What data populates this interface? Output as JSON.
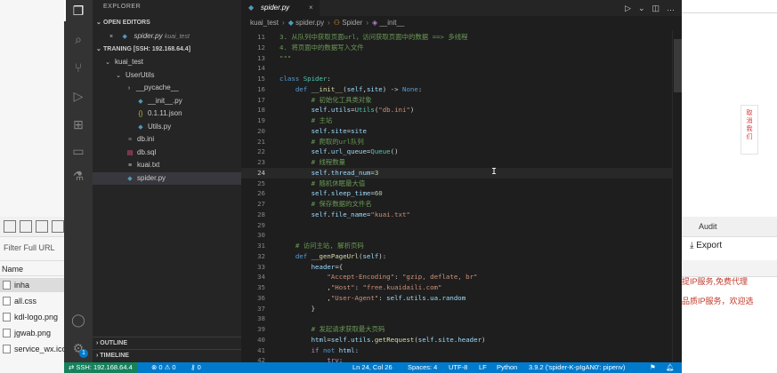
{
  "background": {
    "left": {
      "filter_placeholder": "Filter Full URL",
      "name_header": "Name",
      "files": [
        {
          "name": "inha",
          "selected": true
        },
        {
          "name": "all.css",
          "selected": false
        },
        {
          "name": "kdl-logo.png",
          "selected": false
        },
        {
          "name": "jgwab.png",
          "selected": false
        },
        {
          "name": "service_wx.ico",
          "selected": false
        }
      ]
    },
    "right": {
      "side_button": "取\n消\n我\n们",
      "audit": "Audit",
      "export": "Export",
      "red_text_1": "提IP服务,免费代理",
      "red_text_2": "品质IP服务，欢迎选"
    }
  },
  "vscode": {
    "explorer_title": "EXPLORER",
    "open_editors_label": "OPEN EDITORS",
    "open_editor": {
      "close": "×",
      "name": "spider.py",
      "path": "kuai_test"
    },
    "workspace_label": "TRANING [SSH: 192.168.64.4]",
    "tree": [
      {
        "label": "kuai_test",
        "chevron": "⌄",
        "icon": "",
        "depth": 1
      },
      {
        "label": "UserUtils",
        "chevron": "⌄",
        "icon": "",
        "depth": 2
      },
      {
        "label": "__pycache__",
        "chevron": "›",
        "icon": "",
        "depth": 3
      },
      {
        "label": "__init__.py",
        "chevron": "",
        "icon": "py",
        "depth": 3
      },
      {
        "label": "0.1.11.json",
        "chevron": "",
        "icon": "{}",
        "depth": 3
      },
      {
        "label": "Utils.py",
        "chevron": "",
        "icon": "py",
        "depth": 3
      },
      {
        "label": "db.ini",
        "chevron": "",
        "icon": "ini",
        "depth": 2
      },
      {
        "label": "db.sql",
        "chevron": "",
        "icon": "db",
        "depth": 2
      },
      {
        "label": "kuai.txt",
        "chevron": "",
        "icon": "txt",
        "depth": 2
      },
      {
        "label": "spider.py",
        "chevron": "",
        "icon": "py",
        "depth": 2,
        "selected": true
      }
    ],
    "outline_label": "OUTLINE",
    "timeline_label": "TIMELINE",
    "tab": {
      "name": "spider.py",
      "close": "×"
    },
    "breadcrumb": {
      "folder": "kuai_test",
      "file": "spider.py",
      "class": "Spider",
      "method": "__init__"
    },
    "status": {
      "remote": "SSH: 192.168.64.4",
      "problems": "⊗ 0 ⚠ 0",
      "ports": "0",
      "position": "Ln 24, Col 26",
      "spaces": "Spaces: 4",
      "encoding": "UTF-8",
      "eol": "LF",
      "language": "Python",
      "interpreter": "3.9.2 ('spider-K-pIgAN0': pipenv)",
      "badge": "1"
    },
    "code": [
      {
        "n": "11",
        "t": [
          [
            "cmt",
            "3. 从队列中获取页面url，访问获取页面中的数据 ==> 多线程"
          ]
        ]
      },
      {
        "n": "12",
        "t": [
          [
            "cmt",
            "4. 将页面中的数据写入文件"
          ]
        ]
      },
      {
        "n": "13",
        "t": [
          [
            "cmt",
            "\"\"\""
          ]
        ]
      },
      {
        "n": "14",
        "t": []
      },
      {
        "n": "15",
        "t": [
          [
            "kw",
            "class "
          ],
          [
            "cls",
            "Spider"
          ],
          [
            "plain",
            ":"
          ]
        ]
      },
      {
        "n": "16",
        "t": [
          [
            "plain",
            "    "
          ],
          [
            "kw",
            "def "
          ],
          [
            "fn",
            "__init__"
          ],
          [
            "plain",
            "("
          ],
          [
            "var",
            "self"
          ],
          [
            "plain",
            ","
          ],
          [
            "var",
            "site"
          ],
          [
            "plain",
            ") -> "
          ],
          [
            "kw",
            "None"
          ],
          [
            "plain",
            ":"
          ]
        ]
      },
      {
        "n": "17",
        "t": [
          [
            "plain",
            "        "
          ],
          [
            "cmt",
            "# 初始化工具类对象"
          ]
        ]
      },
      {
        "n": "18",
        "t": [
          [
            "plain",
            "        "
          ],
          [
            "var",
            "self"
          ],
          [
            "plain",
            "."
          ],
          [
            "var",
            "utils"
          ],
          [
            "plain",
            "="
          ],
          [
            "cls",
            "Utils"
          ],
          [
            "plain",
            "("
          ],
          [
            "str",
            "\"db.ini\""
          ],
          [
            "plain",
            ")"
          ]
        ]
      },
      {
        "n": "19",
        "t": [
          [
            "plain",
            "        "
          ],
          [
            "cmt",
            "# 主站"
          ]
        ]
      },
      {
        "n": "20",
        "t": [
          [
            "plain",
            "        "
          ],
          [
            "var",
            "self"
          ],
          [
            "plain",
            "."
          ],
          [
            "var",
            "site"
          ],
          [
            "plain",
            "="
          ],
          [
            "var",
            "site"
          ]
        ]
      },
      {
        "n": "21",
        "t": [
          [
            "plain",
            "        "
          ],
          [
            "cmt",
            "# 爬取的url队列"
          ]
        ]
      },
      {
        "n": "22",
        "t": [
          [
            "plain",
            "        "
          ],
          [
            "var",
            "self"
          ],
          [
            "plain",
            "."
          ],
          [
            "var",
            "url_queue"
          ],
          [
            "plain",
            "="
          ],
          [
            "cls",
            "Queue"
          ],
          [
            "plain",
            "()"
          ]
        ]
      },
      {
        "n": "23",
        "t": [
          [
            "plain",
            "        "
          ],
          [
            "cmt",
            "# 线程数量"
          ]
        ]
      },
      {
        "n": "24",
        "t": [
          [
            "plain",
            "        "
          ],
          [
            "var",
            "self"
          ],
          [
            "plain",
            "."
          ],
          [
            "var",
            "thread_num"
          ],
          [
            "plain",
            "="
          ],
          [
            "num",
            "3"
          ]
        ],
        "current": true
      },
      {
        "n": "25",
        "t": [
          [
            "plain",
            "        "
          ],
          [
            "cmt",
            "# 随机休眠最大值"
          ]
        ]
      },
      {
        "n": "26",
        "t": [
          [
            "plain",
            "        "
          ],
          [
            "var",
            "self"
          ],
          [
            "plain",
            "."
          ],
          [
            "var",
            "sleep_time"
          ],
          [
            "plain",
            "="
          ],
          [
            "num",
            "60"
          ]
        ]
      },
      {
        "n": "27",
        "t": [
          [
            "plain",
            "        "
          ],
          [
            "cmt",
            "# 保存数据的文件名"
          ]
        ]
      },
      {
        "n": "28",
        "t": [
          [
            "plain",
            "        "
          ],
          [
            "var",
            "self"
          ],
          [
            "plain",
            "."
          ],
          [
            "var",
            "file_name"
          ],
          [
            "plain",
            "="
          ],
          [
            "str",
            "\"kuai.txt\""
          ]
        ]
      },
      {
        "n": "29",
        "t": []
      },
      {
        "n": "30",
        "t": []
      },
      {
        "n": "31",
        "t": [
          [
            "plain",
            "    "
          ],
          [
            "cmt",
            "# 访问主站, 解析页码"
          ]
        ]
      },
      {
        "n": "32",
        "t": [
          [
            "plain",
            "    "
          ],
          [
            "kw",
            "def "
          ],
          [
            "fn",
            "__genPageUrl"
          ],
          [
            "plain",
            "("
          ],
          [
            "var",
            "self"
          ],
          [
            "plain",
            "):"
          ]
        ]
      },
      {
        "n": "33",
        "t": [
          [
            "plain",
            "        "
          ],
          [
            "var",
            "header"
          ],
          [
            "plain",
            "={"
          ]
        ]
      },
      {
        "n": "34",
        "t": [
          [
            "plain",
            "            "
          ],
          [
            "str",
            "\"Accept-Encoding\""
          ],
          [
            "plain",
            ": "
          ],
          [
            "str",
            "\"gzip, deflate, br\""
          ]
        ]
      },
      {
        "n": "35",
        "t": [
          [
            "plain",
            "            ,"
          ],
          [
            "str",
            "\"Host\""
          ],
          [
            "plain",
            ": "
          ],
          [
            "str",
            "\"free.kuaidaili.com\""
          ]
        ]
      },
      {
        "n": "36",
        "t": [
          [
            "plain",
            "            ,"
          ],
          [
            "str",
            "\"User-Agent\""
          ],
          [
            "plain",
            ": "
          ],
          [
            "var",
            "self"
          ],
          [
            "plain",
            "."
          ],
          [
            "var",
            "utils"
          ],
          [
            "plain",
            "."
          ],
          [
            "var",
            "ua"
          ],
          [
            "plain",
            "."
          ],
          [
            "var",
            "random"
          ]
        ]
      },
      {
        "n": "37",
        "t": [
          [
            "plain",
            "        }"
          ]
        ]
      },
      {
        "n": "38",
        "t": []
      },
      {
        "n": "39",
        "t": [
          [
            "plain",
            "        "
          ],
          [
            "cmt",
            "# 发起请求获取最大页码"
          ]
        ]
      },
      {
        "n": "40",
        "t": [
          [
            "plain",
            "        "
          ],
          [
            "var",
            "html"
          ],
          [
            "plain",
            "="
          ],
          [
            "var",
            "self"
          ],
          [
            "plain",
            "."
          ],
          [
            "var",
            "utils"
          ],
          [
            "plain",
            "."
          ],
          [
            "fn",
            "getRequest"
          ],
          [
            "plain",
            "("
          ],
          [
            "var",
            "self"
          ],
          [
            "plain",
            "."
          ],
          [
            "var",
            "site"
          ],
          [
            "plain",
            "."
          ],
          [
            "var",
            "header"
          ],
          [
            "plain",
            ")"
          ]
        ]
      },
      {
        "n": "41",
        "t": [
          [
            "plain",
            "        "
          ],
          [
            "kw2",
            "if "
          ],
          [
            "kw",
            "not "
          ],
          [
            "var",
            "html"
          ],
          [
            "plain",
            ":"
          ]
        ]
      },
      {
        "n": "42",
        "t": [
          [
            "plain",
            "            "
          ],
          [
            "kw2",
            "try"
          ],
          [
            "plain",
            ":"
          ]
        ]
      }
    ]
  }
}
